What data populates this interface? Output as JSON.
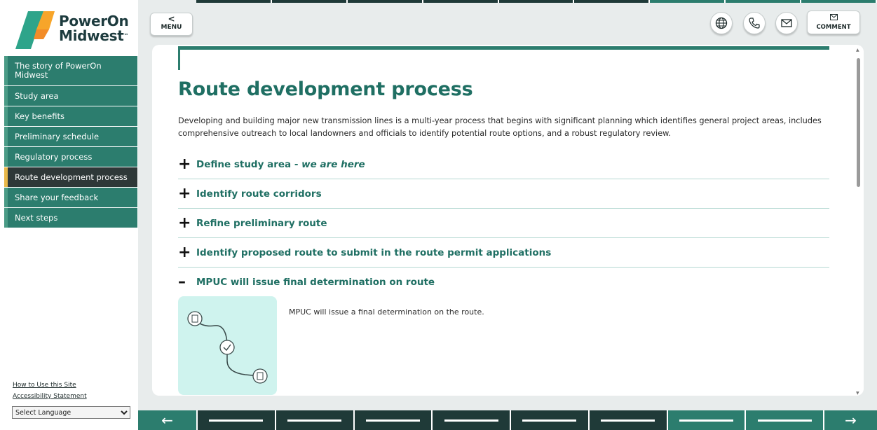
{
  "brand": {
    "line1": "PowerOn",
    "line2": "Midwest",
    "tm": "™"
  },
  "sidebar": {
    "items": [
      {
        "label": "The story of PowerOn Midwest"
      },
      {
        "label": "Study area"
      },
      {
        "label": "Key benefits"
      },
      {
        "label": "Preliminary schedule"
      },
      {
        "label": "Regulatory process"
      },
      {
        "label": "Route development process"
      },
      {
        "label": "Share your feedback"
      },
      {
        "label": "Next steps"
      }
    ],
    "links": {
      "how_to": "How to Use this Site",
      "accessibility": "Accessibility Statement"
    },
    "language_select": "Select Language"
  },
  "toolbar": {
    "menu_chevron": "<",
    "menu_label": "MENU",
    "comment_label": "COMMENT"
  },
  "content": {
    "heading": "Route development process",
    "intro": "Developing and building major new transmission lines is a multi-year process that begins with significant planning which identifies general project areas, includes comprehensive outreach to local landowners and officials to identify potential route options, and a robust regulatory review.",
    "accordion": [
      {
        "sign": "+",
        "title": "Define study area - ",
        "title_em": "we are here"
      },
      {
        "sign": "+",
        "title": "Identify route corridors"
      },
      {
        "sign": "+",
        "title": "Refine preliminary route"
      },
      {
        "sign": "+",
        "title": "Identify proposed route to submit in the route permit applications"
      },
      {
        "sign": "–",
        "title": "MPUC will issue final determination on route"
      }
    ],
    "open_body": "MPUC will issue a final determination on the route."
  },
  "bottom_nav": {
    "left_arrow": "←",
    "right_arrow": "→"
  },
  "colors": {
    "brand_green": "#2c7d6e",
    "heading_green": "#1f6f63",
    "dark_bar": "#1f3a38",
    "active_marker": "#e8b84a",
    "route_panel": "#cff3ee"
  }
}
